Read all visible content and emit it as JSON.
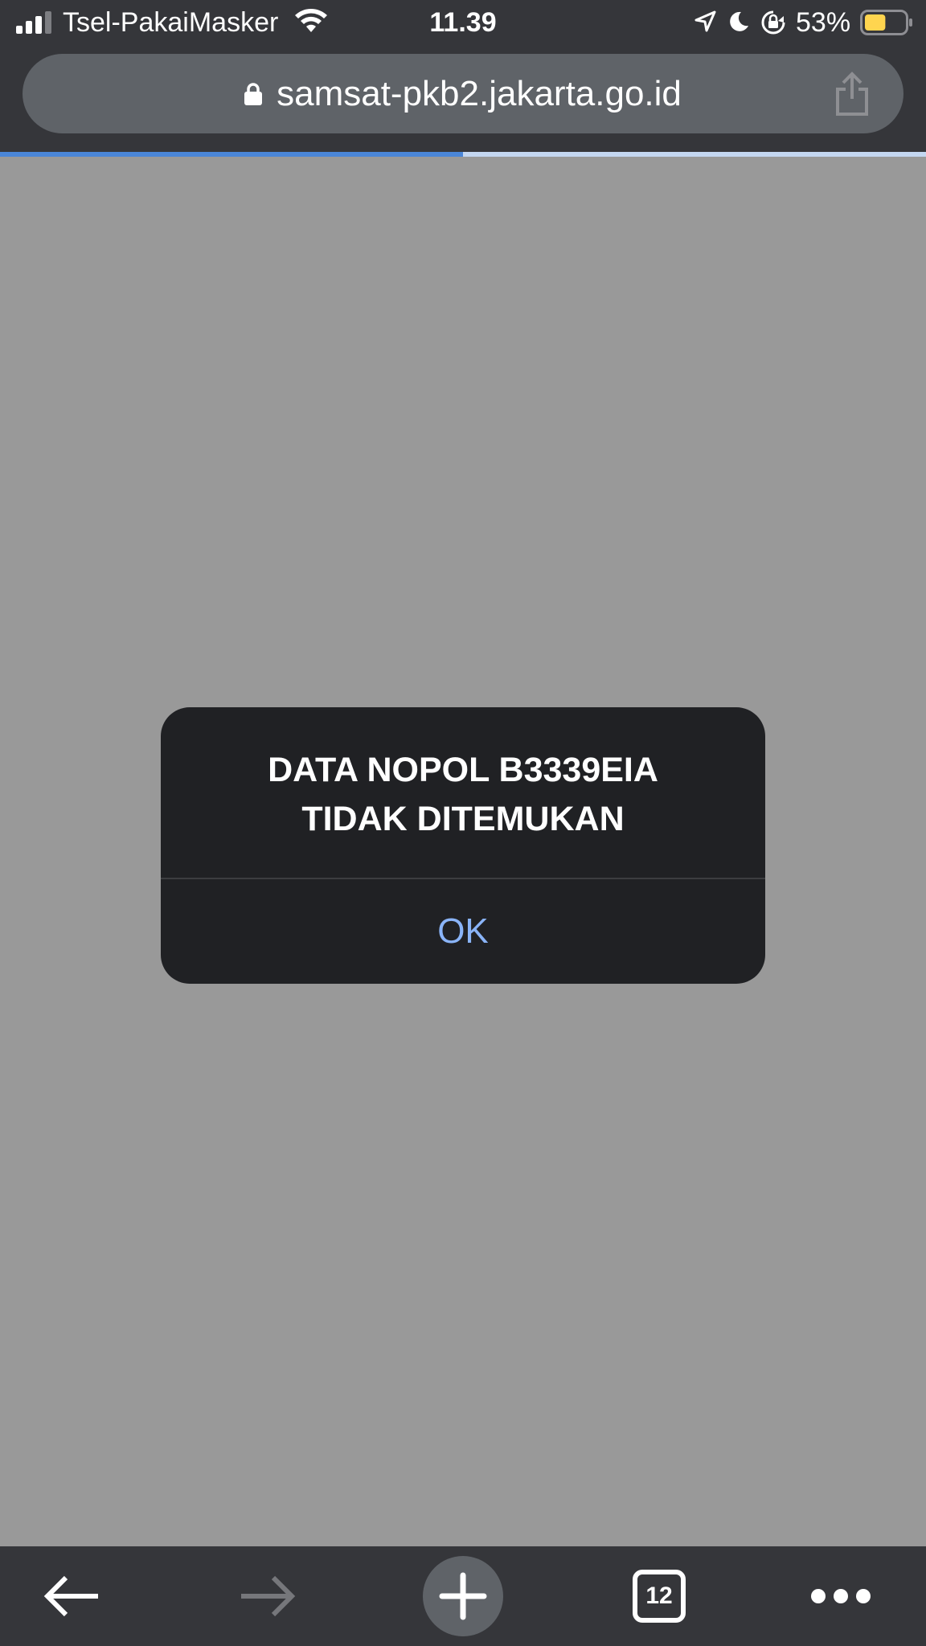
{
  "status_bar": {
    "carrier": "Tsel-PakaiMasker",
    "time": "11.39",
    "battery_percent": "53%",
    "battery_level": 0.53,
    "battery_color": "#ffd54f",
    "icons": [
      "signal-icon",
      "wifi-icon",
      "location-arrow-icon",
      "moon-icon",
      "rotation-lock-icon",
      "battery-icon"
    ]
  },
  "browser": {
    "url": "samsat-pkb2.jakarta.go.id",
    "secure": true,
    "load_progress": 0.5,
    "progress_color": "#4a86d8",
    "icons": [
      "lock-icon",
      "share-icon"
    ]
  },
  "dialog": {
    "message_line1": "DATA NOPOL B3339EIA",
    "message_line2": "TIDAK DITEMUKAN",
    "ok_label": "OK",
    "ok_color": "#8ab4f8"
  },
  "toolbar": {
    "tab_count": "12",
    "icons": [
      "back-arrow-icon",
      "forward-arrow-icon",
      "plus-icon",
      "tab-switcher-icon",
      "more-dots-icon"
    ]
  }
}
